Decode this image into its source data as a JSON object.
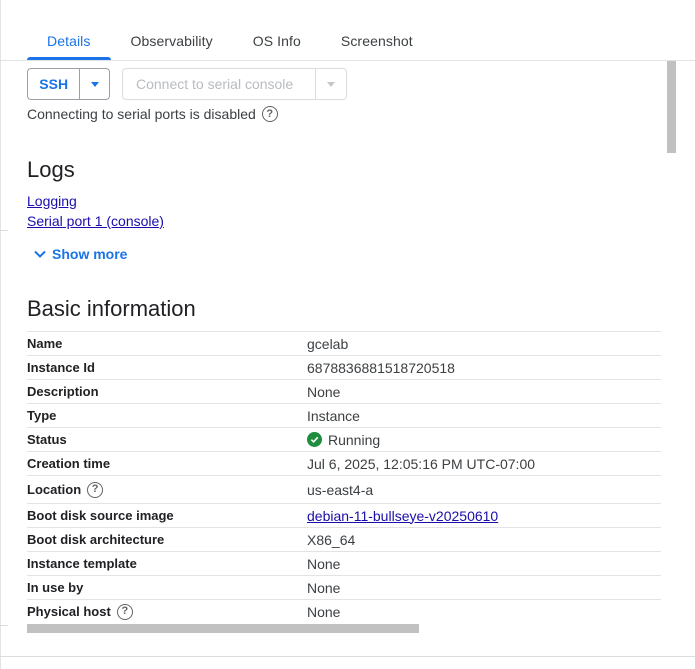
{
  "tabs": [
    {
      "label": "Details"
    },
    {
      "label": "Observability"
    },
    {
      "label": "OS Info"
    },
    {
      "label": "Screenshot"
    }
  ],
  "active_tab": "Details",
  "actions": {
    "ssh_label": "SSH",
    "serial_label": "Connect to serial console",
    "serial_note": "Connecting to serial ports is disabled"
  },
  "logs": {
    "title": "Logs",
    "links": [
      "Logging",
      "Serial port 1 (console)"
    ],
    "show_more": "Show more"
  },
  "basic_info": {
    "title": "Basic information",
    "rows": [
      {
        "key": "Name",
        "value": "gcelab"
      },
      {
        "key": "Instance Id",
        "value": "6878836881518720518"
      },
      {
        "key": "Description",
        "value": "None"
      },
      {
        "key": "Type",
        "value": "Instance"
      },
      {
        "key": "Status",
        "value": "Running"
      },
      {
        "key": "Creation time",
        "value": "Jul 6, 2025, 12:05:16 PM UTC-07:00"
      },
      {
        "key": "Location",
        "value": "us-east4-a"
      },
      {
        "key": "Boot disk source image",
        "value": "debian-11-bullseye-v20250610"
      },
      {
        "key": "Boot disk architecture",
        "value": "X86_64"
      },
      {
        "key": "Instance template",
        "value": "None"
      },
      {
        "key": "In use by",
        "value": "None"
      },
      {
        "key": "Physical host",
        "value": "None"
      }
    ]
  },
  "colors": {
    "accent": "#1a73e8",
    "link": "#1a0dab",
    "status_ok": "#1e8e3e"
  }
}
